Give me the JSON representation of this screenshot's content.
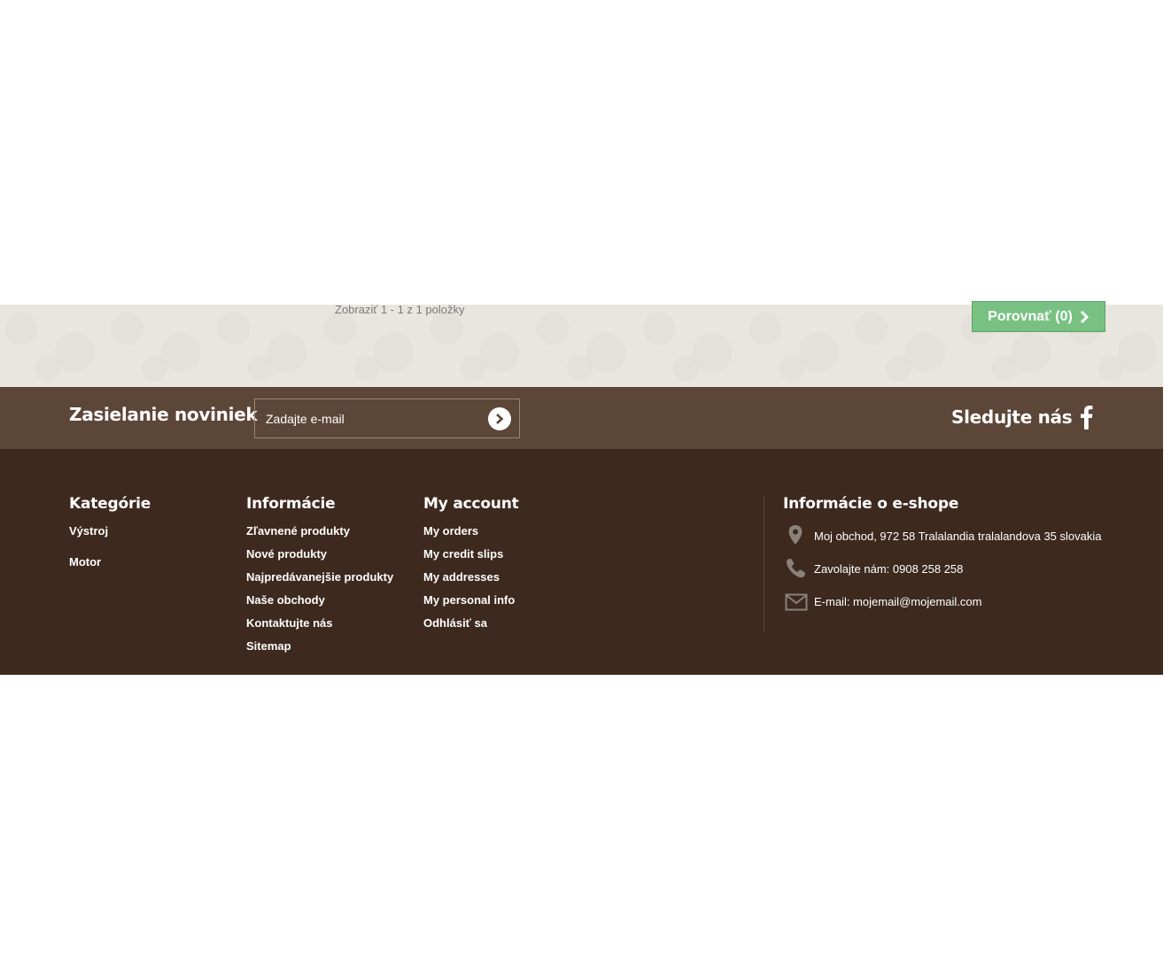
{
  "product_list": {
    "count_text": "Zobraziť 1 - 1 z 1 položky",
    "compare_button": "Porovnať (0)"
  },
  "newsletter": {
    "title": "Zasielanie noviniek",
    "email_placeholder": "Zadajte e-mail",
    "follow_title": "Sledujte nás",
    "social_icon": "facebook-icon"
  },
  "footer": {
    "categories": {
      "title": "Kategórie",
      "items": [
        "Výstroj",
        "Motor"
      ]
    },
    "information": {
      "title": "Informácie",
      "items": [
        "Zľavnené produkty",
        "Nové produkty",
        "Najpredávanejšie produkty",
        "Naše obchody",
        "Kontaktujte nás",
        "Sitemap"
      ]
    },
    "account": {
      "title": "My account",
      "items": [
        "My orders",
        "My credit slips",
        "My addresses",
        "My personal info",
        "Odhlásiť sa"
      ]
    },
    "store": {
      "title": "Informácie o e-shope",
      "address": "Moj obchod, 972 58 Tralalandia tralalandova 35 slovakia",
      "phone": "Zavolajte nám: 0908 258 258",
      "email": "E-mail: mojemail@mojemail.com"
    }
  },
  "colors": {
    "newsletter_bg": "#5c4638",
    "footer_bg": "#3d291e",
    "compare_green": "#78c183",
    "list_bg": "#e8e6de"
  }
}
